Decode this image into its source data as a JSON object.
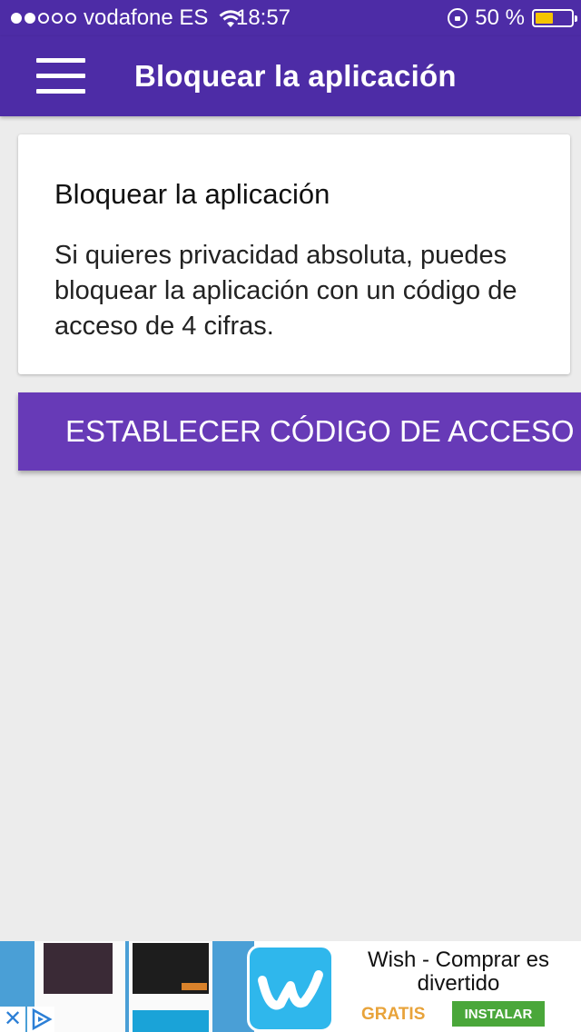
{
  "status_bar": {
    "carrier": "vodafone ES",
    "time": "18:57",
    "battery_text": "50 %",
    "battery_level": 0.5,
    "signal_bars_filled": 2,
    "signal_bars_total": 5
  },
  "app_bar": {
    "title": "Bloquear la aplicación",
    "menu_icon": "hamburger-menu-icon"
  },
  "card": {
    "title": "Bloquear la aplicación",
    "body": "Si quieres privacidad absoluta, puedes bloquear la aplicación con un código de acceso de 4 cifras."
  },
  "action_button": {
    "label": "ESTABLECER CÓDIGO DE ACCESO"
  },
  "ad": {
    "title": "Wish - Comprar es divertido",
    "price_label": "GRATIS",
    "install_label": "INSTALAR",
    "close_icon": "close-icon",
    "adchoices_icon": "adchoices-icon"
  },
  "colors": {
    "primary_dark": "#4d2ca6",
    "primary": "#673ab7",
    "background": "#ececec",
    "ad_install": "#4aa73a",
    "ad_free": "#e8a33a",
    "wish_logo": "#2fb7ec",
    "battery_fill": "#f5c400"
  }
}
